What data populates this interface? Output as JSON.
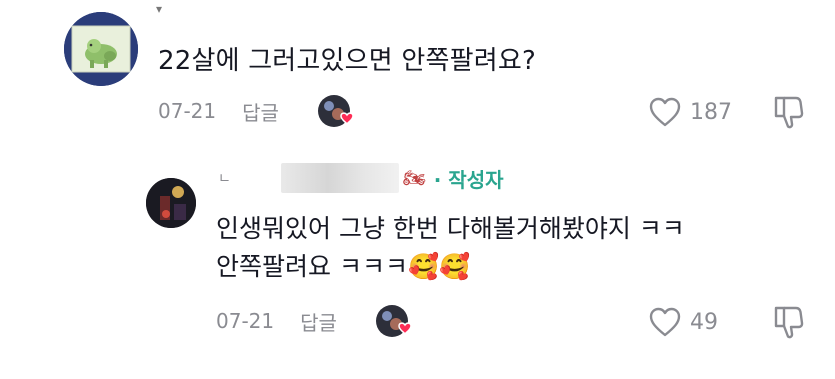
{
  "top_comment": {
    "username_faint": "▾",
    "text": "22살에 그러고있으면 안쪽팔려요?",
    "date": "07-21",
    "reply_label": "답글",
    "like_count": "187"
  },
  "reply_comment": {
    "username_prefix": "ㄴ",
    "author_badge": "· 작성자",
    "name_emoji": "🏍",
    "text_line1": "인생뭐있어 그냥 한번 다해볼거해봤야지 ㅋㅋ",
    "text_line2": "안쪽팔려요 ㅋㅋㅋ🥰🥰",
    "date": "07-21",
    "reply_label": "답글",
    "like_count": "49"
  },
  "colors": {
    "text": "#161823",
    "meta": "#8a8b91",
    "author_badge": "#2aa58f",
    "heart_badge": "#fe2c55"
  }
}
